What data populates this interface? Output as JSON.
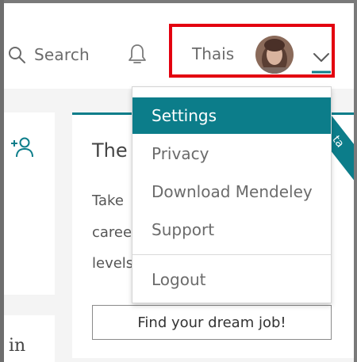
{
  "header": {
    "search_label": "Search",
    "user_name": "Thais",
    "search_icon": "search-icon",
    "bell_icon": "bell-icon",
    "chevron_icon": "chevron-down-icon"
  },
  "sidebar": {
    "add_icon": "add-person-icon",
    "partial_text": "in"
  },
  "card": {
    "title": "The",
    "line1": "Take",
    "line2": "caree",
    "line3": "levels",
    "ribbon": "ta",
    "button_label": "Find your dream job!"
  },
  "menu": {
    "items": [
      {
        "label": "Settings"
      },
      {
        "label": "Privacy"
      },
      {
        "label": "Download Mendeley"
      },
      {
        "label": "Support"
      },
      {
        "label": "Logout"
      }
    ]
  },
  "colors": {
    "accent": "#0c7d8a",
    "highlight_box": "#e3000f"
  }
}
